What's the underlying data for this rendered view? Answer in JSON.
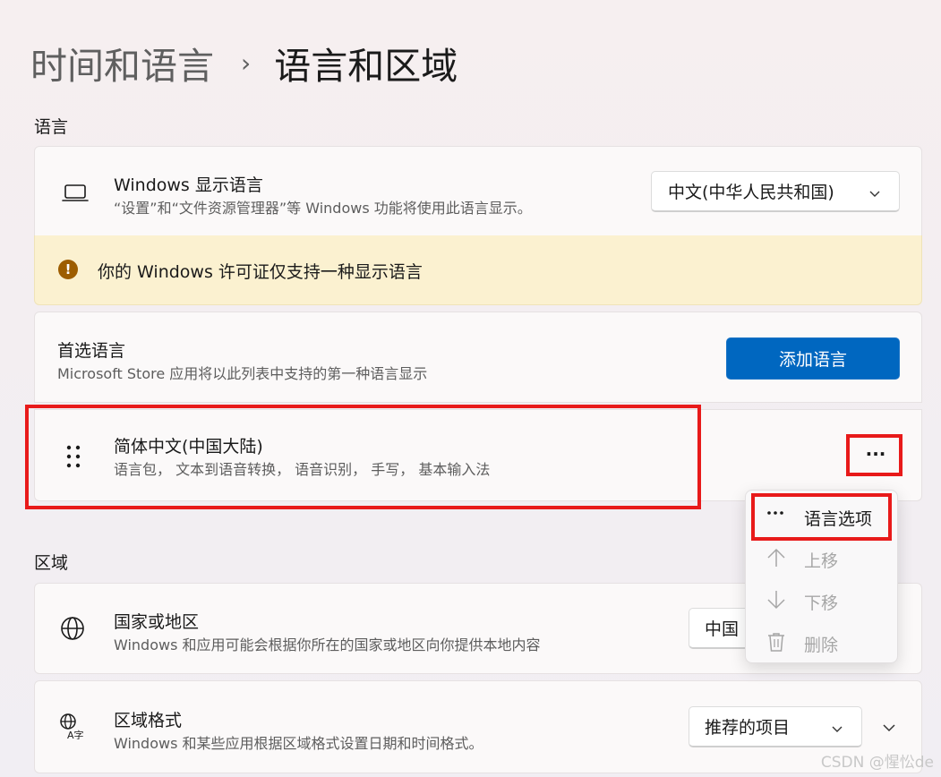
{
  "breadcrumb": {
    "parent": "时间和语言",
    "separator": "›",
    "current": "语言和区域"
  },
  "sections": {
    "language": "语言",
    "region": "区域"
  },
  "display_language": {
    "title": "Windows 显示语言",
    "description": "“设置”和“文件资源管理器”等 Windows 功能将使用此语言显示。",
    "selected": "中文(中华人民共和国)"
  },
  "license_notice": {
    "text": "你的 Windows 许可证仅支持一种显示语言"
  },
  "preferred_languages": {
    "title": "首选语言",
    "description": "Microsoft Store 应用将以此列表中支持的第一种语言显示",
    "add_button": "添加语言",
    "items": [
      {
        "name": "简体中文(中国大陆)",
        "features": "语言包， 文本到语音转换， 语音识别， 手写， 基本输入法",
        "more_label": "···"
      }
    ]
  },
  "context_menu": {
    "items": [
      {
        "label": "语言选项",
        "icon": "ellipsis-icon",
        "enabled": true
      },
      {
        "label": "上移",
        "icon": "arrow-up-icon",
        "enabled": false
      },
      {
        "label": "下移",
        "icon": "arrow-down-icon",
        "enabled": false
      },
      {
        "label": "删除",
        "icon": "trash-icon",
        "enabled": false
      }
    ]
  },
  "country_region": {
    "title": "国家或地区",
    "description": "Windows 和应用可能会根据你所在的国家或地区向你提供本地内容",
    "selected": "中国"
  },
  "regional_format": {
    "title": "区域格式",
    "description": "Windows 和某些应用根据区域格式设置日期和时间格式。",
    "selected": "推荐的项目"
  },
  "watermark": "CSDN @惺忪de",
  "colors": {
    "accent": "#0067c0",
    "highlight_box": "#e81a1a",
    "warning_bg": "#fbf1d0",
    "warning_icon": "#9d5d00"
  }
}
